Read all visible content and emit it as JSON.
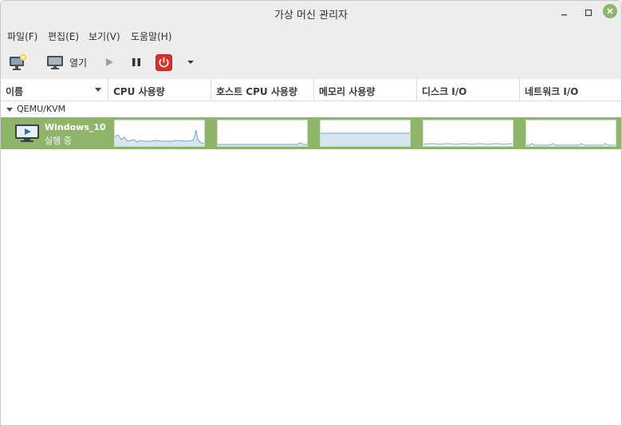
{
  "window": {
    "title": "가상 머신 관리자"
  },
  "menu": {
    "file": "파일(F)",
    "edit": "편집(E)",
    "view": "보기(V)",
    "help": "도움말(H)"
  },
  "toolbar": {
    "open_label": "열기"
  },
  "columns": {
    "name": "이름",
    "cpu": "CPU 사용량",
    "host_cpu": "호스트 CPU 사용량",
    "memory": "메모리 사용량",
    "disk": "디스크 I/O",
    "network": "네트워크 I/O"
  },
  "groups": [
    {
      "label": "QEMU/KVM",
      "vms": [
        {
          "name": "Windows_10",
          "status": "실행 중"
        }
      ]
    }
  ],
  "colors": {
    "selection": "#8fb56b",
    "graph_line": "#7aa6c8",
    "graph_fill": "#d5e6f1",
    "close_button": "#8fb56b",
    "stop_button": "#d9302a"
  }
}
